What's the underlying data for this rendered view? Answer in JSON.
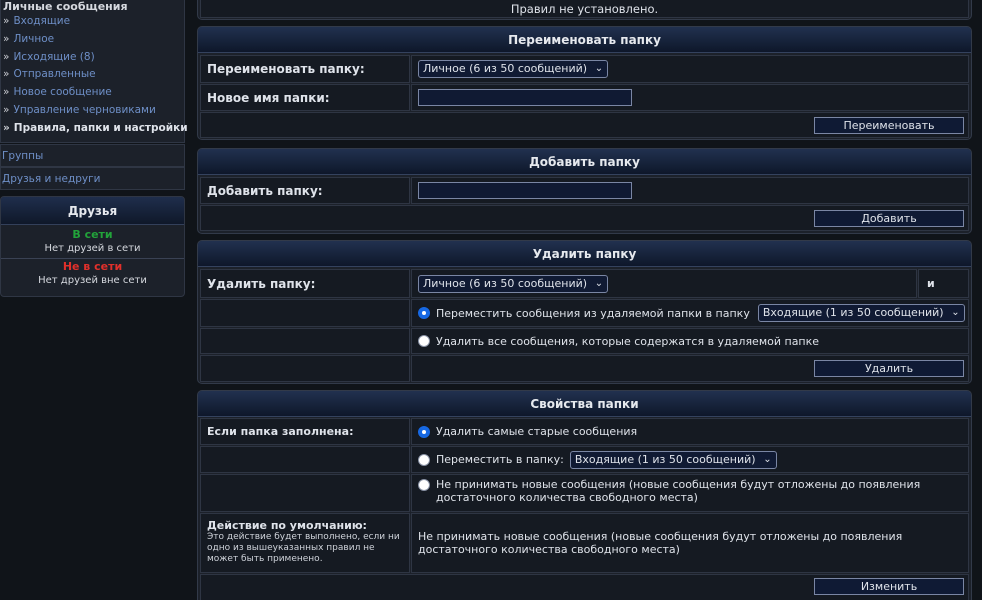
{
  "sidebar": {
    "heading": "Личные сообщения",
    "items": [
      {
        "label": "Входящие"
      },
      {
        "label": "Личное"
      },
      {
        "label": "Исходящие (8)"
      },
      {
        "label": "Отправленные"
      },
      {
        "label": "Новое сообщение"
      },
      {
        "label": "Управление черновиками"
      },
      {
        "label": "Правила, папки и настройки"
      }
    ],
    "groups_link": "Группы",
    "friends_link": "Друзья и недруги",
    "friends_box": {
      "title": "Друзья",
      "online_label": "В сети",
      "online_note": "Нет друзей в сети",
      "offline_label": "Не в сети",
      "offline_note": "Нет друзей вне сети"
    }
  },
  "colors": {
    "online": "#22a33a",
    "offline": "#e0302b",
    "link": "#6e8fc7"
  },
  "rules_panel": {
    "text": "Правил не установлено."
  },
  "rename_panel": {
    "title": "Переименовать папку",
    "folder_label": "Переименовать папку:",
    "folder_select": "Личное (6 из 50 сообщений)",
    "newname_label": "Новое имя папки:",
    "newname_value": "",
    "button": "Переименовать"
  },
  "add_panel": {
    "title": "Добавить папку",
    "label": "Добавить папку:",
    "value": "",
    "button": "Добавить"
  },
  "delete_panel": {
    "title": "Удалить папку",
    "label": "Удалить папку:",
    "folder_select": "Личное (6 из 50 сообщений)",
    "and_text": "и",
    "option_move": "Переместить сообщения из удаляемой папки в папку",
    "move_select": "Входящие (1 из 50 сообщений)",
    "option_delete": "Удалить все сообщения, которые содержатся в удаляемой папке",
    "button": "Удалить"
  },
  "props_panel": {
    "title": "Свойства папки",
    "full_label": "Если папка заполнена:",
    "opt_delete_oldest": "Удалить самые старые сообщения",
    "opt_move": "Переместить в папку:",
    "move_select": "Входящие (1 из 50 сообщений)",
    "opt_reject": "Не принимать новые сообщения (новые сообщения будут отложены до появления достаточного количества свободного места)",
    "default_label": "Действие по умолчанию:",
    "default_note": "Это действие будет выполнено, если ни одно из вышеуказанных правил не может быть применено.",
    "default_value": "Не принимать новые сообщения (новые сообщения будут отложены до появления достаточного количества свободного места)",
    "button": "Изменить"
  }
}
